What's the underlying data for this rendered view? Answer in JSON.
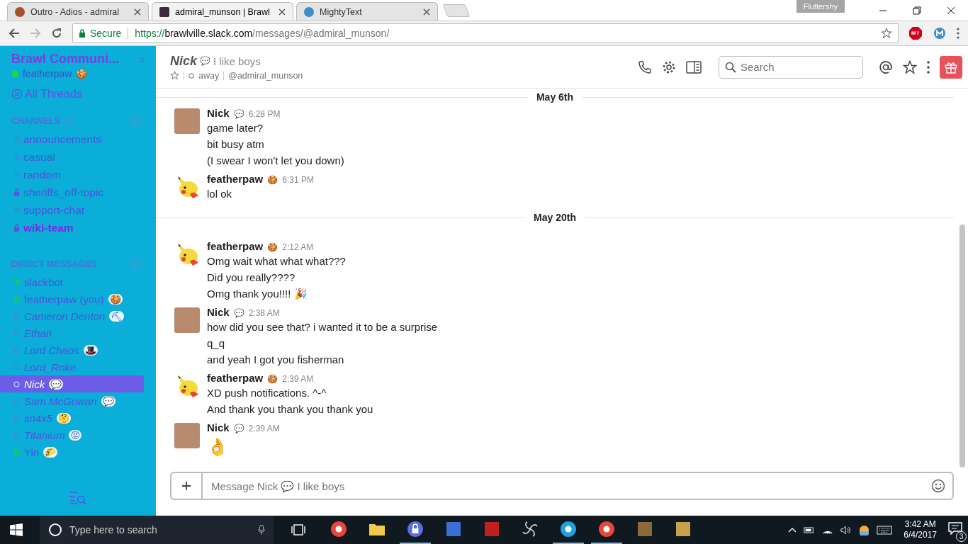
{
  "browser": {
    "tabs": [
      {
        "title": "Outro - Adios - admiral",
        "selected": false
      },
      {
        "title": "admiral_munson | Brawl",
        "selected": true
      },
      {
        "title": "MightyText",
        "selected": false
      }
    ],
    "profile": "Fluttershy",
    "secure_label": "Secure",
    "url": {
      "scheme": "https://",
      "host": "brawlville.slack.com",
      "path": "/messages/@admiral_munson/"
    }
  },
  "sidebar": {
    "team": "Brawl Communi...",
    "user": {
      "name": "featherpaw",
      "emoji": "🍪",
      "online": true
    },
    "all_threads": "All Threads",
    "channels": {
      "heading": "CHANNELS",
      "count": "(6)",
      "items": [
        {
          "name": "announcements",
          "private": false,
          "unread": false
        },
        {
          "name": "casual",
          "private": false,
          "unread": false
        },
        {
          "name": "random",
          "private": false,
          "unread": false
        },
        {
          "name": "sheriffs_off-topic",
          "private": true,
          "unread": false
        },
        {
          "name": "support-chat",
          "private": false,
          "unread": false
        },
        {
          "name": "wiki-team",
          "private": true,
          "unread": true
        }
      ]
    },
    "direct_messages": {
      "heading": "DIRECT MESSAGES",
      "items": [
        {
          "name": "slackbot",
          "kind": "bot",
          "online": true,
          "selected": false
        },
        {
          "name": "featherpaw (you)",
          "kind": "person",
          "online": true,
          "emoji": "🍪",
          "selected": false
        },
        {
          "name": "Cameron Denton",
          "kind": "person",
          "online": false,
          "emoji": "⛏",
          "selected": false
        },
        {
          "name": "Ethan",
          "kind": "person",
          "online": false,
          "selected": false
        },
        {
          "name": "Lord Chaos",
          "kind": "person",
          "online": false,
          "emoji": "🎩",
          "selected": false
        },
        {
          "name": "Lord_Roke",
          "kind": "person",
          "online": false,
          "selected": false
        },
        {
          "name": "Nick",
          "kind": "person",
          "online": false,
          "emoji": "💬",
          "selected": true
        },
        {
          "name": "Sam McGowan",
          "kind": "person",
          "online": false,
          "emoji": "💬",
          "selected": false
        },
        {
          "name": "sn4x5",
          "kind": "person",
          "online": false,
          "emoji": "🤔",
          "selected": false
        },
        {
          "name": "Titanium",
          "kind": "person",
          "online": false,
          "emoji": "😡",
          "selected": false
        },
        {
          "name": "Yin",
          "kind": "person",
          "online": true,
          "emoji": "🌮",
          "selected": false
        }
      ]
    }
  },
  "header": {
    "name": "Nick",
    "status_emoji": "💬",
    "status": "I like boys",
    "presence": "away",
    "handle": "@admiral_munson",
    "search_placeholder": "Search"
  },
  "days": [
    {
      "date": "May 6th",
      "groups": [
        {
          "author": "Nick",
          "kind": "photo",
          "emoji": "💬",
          "time": "6:28 PM",
          "lines": [
            "game later?",
            "bit busy atm",
            "(I swear I won't let you down)"
          ]
        },
        {
          "author": "featherpaw",
          "kind": "cartoon",
          "emoji": "🍪",
          "time": "6:31 PM",
          "lines": [
            "lol ok"
          ]
        }
      ]
    },
    {
      "date": "May 20th",
      "groups": [
        {
          "author": "featherpaw",
          "kind": "cartoon",
          "emoji": "🍪",
          "time": "2:12 AM",
          "lines": [
            "Omg wait what what what???",
            "Did you really????",
            "Omg thank you!!!! 🎉"
          ]
        },
        {
          "author": "Nick",
          "kind": "photo",
          "emoji": "💬",
          "time": "2:38 AM",
          "lines": [
            "how did you see that? i wanted it to be a surprise",
            "q_q",
            "and yeah I got you fisherman"
          ]
        },
        {
          "author": "featherpaw",
          "kind": "cartoon",
          "emoji": "🍪",
          "time": "2:39 AM",
          "lines": [
            "XD push notifications. ^-^",
            "And thank you thank you thank you"
          ]
        },
        {
          "author": "Nick",
          "kind": "photo",
          "emoji": "💬",
          "time": "2:39 AM",
          "jumbo": true,
          "lines": [
            "👌"
          ]
        }
      ]
    }
  ],
  "composer": {
    "placeholder": "Message Nick 💬 I like boys"
  },
  "taskbar": {
    "search_placeholder": "Type here to search",
    "time": "3:42 AM",
    "date": "6/4/2017",
    "notifications": "3"
  }
}
